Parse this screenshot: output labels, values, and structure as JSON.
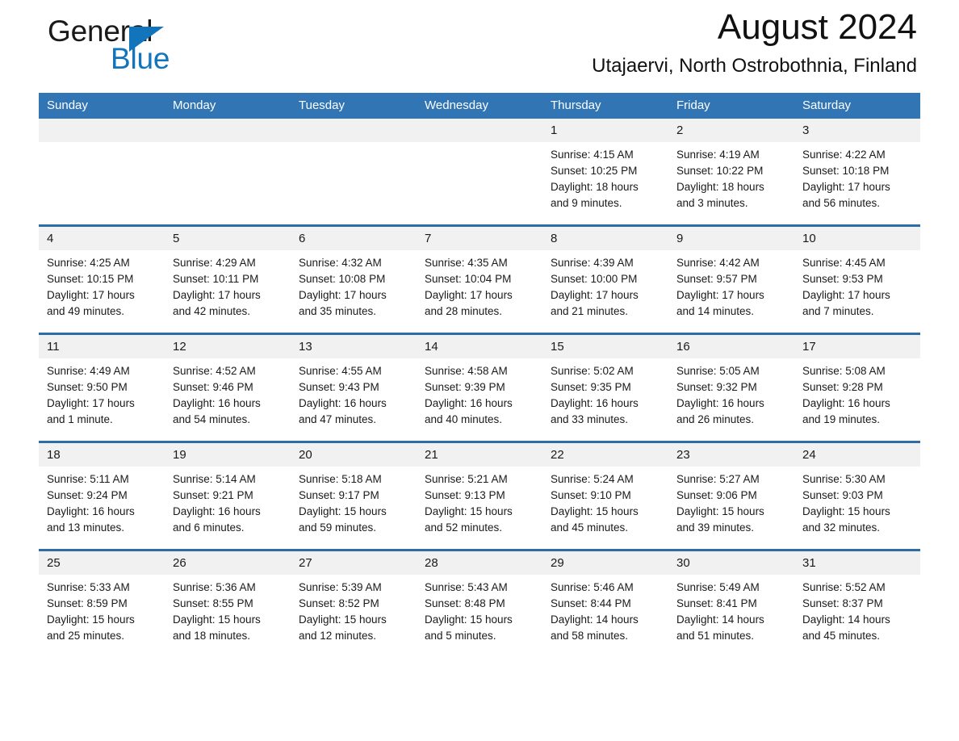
{
  "brand": {
    "word_one": "General",
    "word_two": "Blue",
    "triangle_color": "#1275bc",
    "text_color": "#1a1a1a"
  },
  "header": {
    "title": "August 2024",
    "subtitle": "Utajaervi, North Ostrobothnia, Finland"
  },
  "theme": {
    "header_blue": "#3175b4",
    "row_rule_blue": "#2e6da4",
    "daynum_bg": "#f1f1f1"
  },
  "weekday_headers": [
    "Sunday",
    "Monday",
    "Tuesday",
    "Wednesday",
    "Thursday",
    "Friday",
    "Saturday"
  ],
  "weeks": [
    [
      {
        "day": "",
        "sunrise": "",
        "sunset": "",
        "daylight1": "",
        "daylight2": "",
        "empty": true
      },
      {
        "day": "",
        "sunrise": "",
        "sunset": "",
        "daylight1": "",
        "daylight2": "",
        "empty": true
      },
      {
        "day": "",
        "sunrise": "",
        "sunset": "",
        "daylight1": "",
        "daylight2": "",
        "empty": true
      },
      {
        "day": "",
        "sunrise": "",
        "sunset": "",
        "daylight1": "",
        "daylight2": "",
        "empty": true
      },
      {
        "day": "1",
        "sunrise": "Sunrise: 4:15 AM",
        "sunset": "Sunset: 10:25 PM",
        "daylight1": "Daylight: 18 hours",
        "daylight2": "and 9 minutes."
      },
      {
        "day": "2",
        "sunrise": "Sunrise: 4:19 AM",
        "sunset": "Sunset: 10:22 PM",
        "daylight1": "Daylight: 18 hours",
        "daylight2": "and 3 minutes."
      },
      {
        "day": "3",
        "sunrise": "Sunrise: 4:22 AM",
        "sunset": "Sunset: 10:18 PM",
        "daylight1": "Daylight: 17 hours",
        "daylight2": "and 56 minutes."
      }
    ],
    [
      {
        "day": "4",
        "sunrise": "Sunrise: 4:25 AM",
        "sunset": "Sunset: 10:15 PM",
        "daylight1": "Daylight: 17 hours",
        "daylight2": "and 49 minutes."
      },
      {
        "day": "5",
        "sunrise": "Sunrise: 4:29 AM",
        "sunset": "Sunset: 10:11 PM",
        "daylight1": "Daylight: 17 hours",
        "daylight2": "and 42 minutes."
      },
      {
        "day": "6",
        "sunrise": "Sunrise: 4:32 AM",
        "sunset": "Sunset: 10:08 PM",
        "daylight1": "Daylight: 17 hours",
        "daylight2": "and 35 minutes."
      },
      {
        "day": "7",
        "sunrise": "Sunrise: 4:35 AM",
        "sunset": "Sunset: 10:04 PM",
        "daylight1": "Daylight: 17 hours",
        "daylight2": "and 28 minutes."
      },
      {
        "day": "8",
        "sunrise": "Sunrise: 4:39 AM",
        "sunset": "Sunset: 10:00 PM",
        "daylight1": "Daylight: 17 hours",
        "daylight2": "and 21 minutes."
      },
      {
        "day": "9",
        "sunrise": "Sunrise: 4:42 AM",
        "sunset": "Sunset: 9:57 PM",
        "daylight1": "Daylight: 17 hours",
        "daylight2": "and 14 minutes."
      },
      {
        "day": "10",
        "sunrise": "Sunrise: 4:45 AM",
        "sunset": "Sunset: 9:53 PM",
        "daylight1": "Daylight: 17 hours",
        "daylight2": "and 7 minutes."
      }
    ],
    [
      {
        "day": "11",
        "sunrise": "Sunrise: 4:49 AM",
        "sunset": "Sunset: 9:50 PM",
        "daylight1": "Daylight: 17 hours",
        "daylight2": "and 1 minute."
      },
      {
        "day": "12",
        "sunrise": "Sunrise: 4:52 AM",
        "sunset": "Sunset: 9:46 PM",
        "daylight1": "Daylight: 16 hours",
        "daylight2": "and 54 minutes."
      },
      {
        "day": "13",
        "sunrise": "Sunrise: 4:55 AM",
        "sunset": "Sunset: 9:43 PM",
        "daylight1": "Daylight: 16 hours",
        "daylight2": "and 47 minutes."
      },
      {
        "day": "14",
        "sunrise": "Sunrise: 4:58 AM",
        "sunset": "Sunset: 9:39 PM",
        "daylight1": "Daylight: 16 hours",
        "daylight2": "and 40 minutes."
      },
      {
        "day": "15",
        "sunrise": "Sunrise: 5:02 AM",
        "sunset": "Sunset: 9:35 PM",
        "daylight1": "Daylight: 16 hours",
        "daylight2": "and 33 minutes."
      },
      {
        "day": "16",
        "sunrise": "Sunrise: 5:05 AM",
        "sunset": "Sunset: 9:32 PM",
        "daylight1": "Daylight: 16 hours",
        "daylight2": "and 26 minutes."
      },
      {
        "day": "17",
        "sunrise": "Sunrise: 5:08 AM",
        "sunset": "Sunset: 9:28 PM",
        "daylight1": "Daylight: 16 hours",
        "daylight2": "and 19 minutes."
      }
    ],
    [
      {
        "day": "18",
        "sunrise": "Sunrise: 5:11 AM",
        "sunset": "Sunset: 9:24 PM",
        "daylight1": "Daylight: 16 hours",
        "daylight2": "and 13 minutes."
      },
      {
        "day": "19",
        "sunrise": "Sunrise: 5:14 AM",
        "sunset": "Sunset: 9:21 PM",
        "daylight1": "Daylight: 16 hours",
        "daylight2": "and 6 minutes."
      },
      {
        "day": "20",
        "sunrise": "Sunrise: 5:18 AM",
        "sunset": "Sunset: 9:17 PM",
        "daylight1": "Daylight: 15 hours",
        "daylight2": "and 59 minutes."
      },
      {
        "day": "21",
        "sunrise": "Sunrise: 5:21 AM",
        "sunset": "Sunset: 9:13 PM",
        "daylight1": "Daylight: 15 hours",
        "daylight2": "and 52 minutes."
      },
      {
        "day": "22",
        "sunrise": "Sunrise: 5:24 AM",
        "sunset": "Sunset: 9:10 PM",
        "daylight1": "Daylight: 15 hours",
        "daylight2": "and 45 minutes."
      },
      {
        "day": "23",
        "sunrise": "Sunrise: 5:27 AM",
        "sunset": "Sunset: 9:06 PM",
        "daylight1": "Daylight: 15 hours",
        "daylight2": "and 39 minutes."
      },
      {
        "day": "24",
        "sunrise": "Sunrise: 5:30 AM",
        "sunset": "Sunset: 9:03 PM",
        "daylight1": "Daylight: 15 hours",
        "daylight2": "and 32 minutes."
      }
    ],
    [
      {
        "day": "25",
        "sunrise": "Sunrise: 5:33 AM",
        "sunset": "Sunset: 8:59 PM",
        "daylight1": "Daylight: 15 hours",
        "daylight2": "and 25 minutes."
      },
      {
        "day": "26",
        "sunrise": "Sunrise: 5:36 AM",
        "sunset": "Sunset: 8:55 PM",
        "daylight1": "Daylight: 15 hours",
        "daylight2": "and 18 minutes."
      },
      {
        "day": "27",
        "sunrise": "Sunrise: 5:39 AM",
        "sunset": "Sunset: 8:52 PM",
        "daylight1": "Daylight: 15 hours",
        "daylight2": "and 12 minutes."
      },
      {
        "day": "28",
        "sunrise": "Sunrise: 5:43 AM",
        "sunset": "Sunset: 8:48 PM",
        "daylight1": "Daylight: 15 hours",
        "daylight2": "and 5 minutes."
      },
      {
        "day": "29",
        "sunrise": "Sunrise: 5:46 AM",
        "sunset": "Sunset: 8:44 PM",
        "daylight1": "Daylight: 14 hours",
        "daylight2": "and 58 minutes."
      },
      {
        "day": "30",
        "sunrise": "Sunrise: 5:49 AM",
        "sunset": "Sunset: 8:41 PM",
        "daylight1": "Daylight: 14 hours",
        "daylight2": "and 51 minutes."
      },
      {
        "day": "31",
        "sunrise": "Sunrise: 5:52 AM",
        "sunset": "Sunset: 8:37 PM",
        "daylight1": "Daylight: 14 hours",
        "daylight2": "and 45 minutes."
      }
    ]
  ]
}
